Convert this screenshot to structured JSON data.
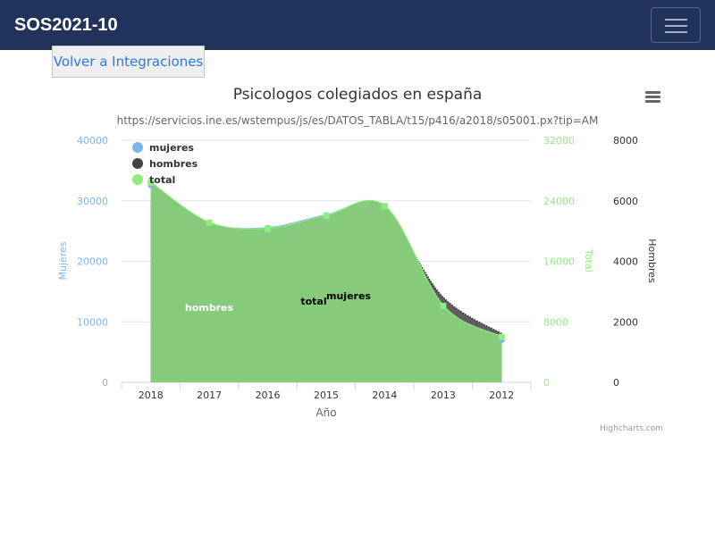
{
  "navbar": {
    "brand": "SOS2021-10",
    "toggle_icon": "hamburger-icon"
  },
  "back_button": {
    "label": "Volver a Integraciones"
  },
  "chart_menu": {
    "icon": "context-menu-icon"
  },
  "credits": "Highcharts.com",
  "colors": {
    "navbar": "#21335b",
    "mujeres": "#7cb5ec",
    "hombres": "#434348",
    "total": "#90ed7d",
    "axis_mujeres": "#7cb5ec",
    "axis_total": "#90ed7d",
    "axis_hombres": "#333333"
  },
  "chart_data": {
    "type": "area",
    "title": "Psicologos colegiados en españa",
    "subtitle": "https://servicios.ine.es/wstempus/js/es/DATOS_TABLA/t15/p416/a2018/s05001.px?tip=AM",
    "xlabel": "Año",
    "categories": [
      "2018",
      "2017",
      "2016",
      "2015",
      "2014",
      "2013",
      "2012"
    ],
    "legend_position": "top-left",
    "series": [
      {
        "name": "mujeres",
        "axis": "mujeres",
        "values": [
          32600,
          26300,
          25500,
          27600,
          29000,
          12400,
          7000
        ]
      },
      {
        "name": "hombres",
        "axis": "hombres",
        "values": [
          6000,
          4900,
          4700,
          4950,
          5450,
          2800,
          1600
        ]
      },
      {
        "name": "total",
        "axis": "total",
        "values": [
          26400,
          21100,
          20300,
          22000,
          23300,
          10100,
          6000
        ]
      }
    ],
    "annotations": [
      "hombres",
      "total",
      "mujeres"
    ],
    "axes": {
      "mujeres": {
        "title": "Mujeres",
        "ylim": [
          0,
          40000
        ],
        "ticks": [
          "40000",
          "30000",
          "20000",
          "10000",
          "0"
        ]
      },
      "total": {
        "title": "Total",
        "ylim": [
          0,
          32000
        ],
        "ticks": [
          "32000",
          "24000",
          "16000",
          "8000",
          "0"
        ]
      },
      "hombres": {
        "title": "Hombres",
        "ylim": [
          0,
          8000
        ],
        "ticks": [
          "8000",
          "6000",
          "4000",
          "2000",
          "0"
        ]
      }
    },
    "grid": true
  }
}
